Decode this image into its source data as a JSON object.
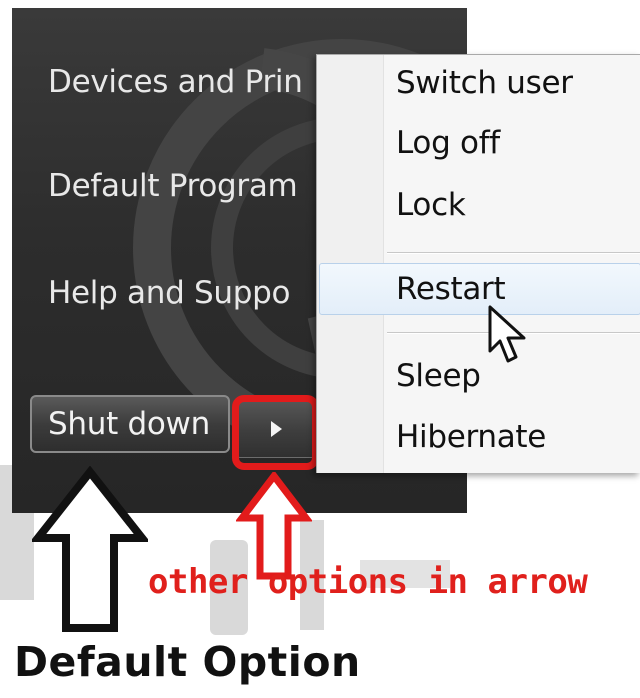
{
  "start_menu": {
    "items": [
      {
        "label": "Devices and Prin"
      },
      {
        "label": "Default Program"
      },
      {
        "label": "Help and Suppo"
      }
    ],
    "shutdown_label": "Shut down",
    "arrow_icon": "triangle-right-icon"
  },
  "popup_menu": {
    "items": [
      {
        "label": "Switch user"
      },
      {
        "label": "Log off"
      },
      {
        "label": "Lock"
      },
      {
        "label": "Restart"
      },
      {
        "label": "Sleep"
      },
      {
        "label": "Hibernate"
      }
    ],
    "hovered": "Restart"
  },
  "annotations": {
    "red_text": "other options in arrow",
    "black_text": "Default Option",
    "red_color": "#e21b1b",
    "black_color": "#111111"
  }
}
